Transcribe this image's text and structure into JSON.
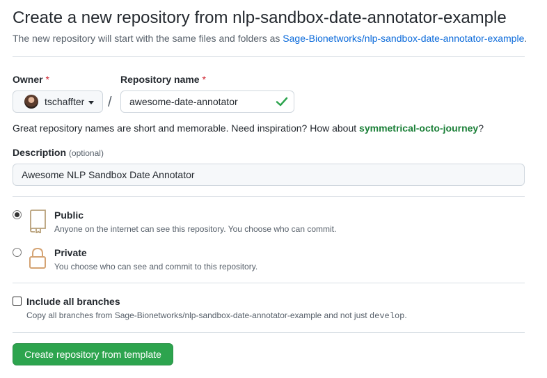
{
  "header": {
    "title": "Create a new repository from nlp-sandbox-date-annotator-example",
    "subtitle_prefix": "The new repository will start with the same files and folders as ",
    "template_link": "Sage-Bionetworks/nlp-sandbox-date-annotator-example",
    "subtitle_suffix": "."
  },
  "owner": {
    "label": "Owner",
    "required_mark": "*",
    "selected": "tschaffter"
  },
  "separator": "/",
  "repo_name": {
    "label": "Repository name",
    "required_mark": "*",
    "value": "awesome-date-annotator",
    "status": "valid"
  },
  "name_hint": {
    "prefix": "Great repository names are short and memorable. Need inspiration? How about ",
    "suggestion": "symmetrical-octo-journey",
    "suffix": "?"
  },
  "description": {
    "label": "Description",
    "optional_label": "(optional)",
    "value": "Awesome NLP Sandbox Date Annotator"
  },
  "visibility": {
    "selected": "public",
    "options": [
      {
        "id": "public",
        "title": "Public",
        "description": "Anyone on the internet can see this repository. You choose who can commit.",
        "icon": "repo-icon"
      },
      {
        "id": "private",
        "title": "Private",
        "description": "You choose who can see and commit to this repository.",
        "icon": "lock-icon"
      }
    ]
  },
  "include_branches": {
    "label": "Include all branches",
    "checked": false,
    "desc_prefix": "Copy all branches from Sage-Bionetworks/nlp-sandbox-date-annotator-example and not just ",
    "branch": "develop",
    "desc_suffix": "."
  },
  "submit": {
    "label": "Create repository from template"
  },
  "colors": {
    "accent_green": "#2da44e",
    "link_blue": "#0969da",
    "required_red": "#cf222e",
    "suggestion_green": "#1a7f37",
    "icon_tan": "#d4a373"
  }
}
